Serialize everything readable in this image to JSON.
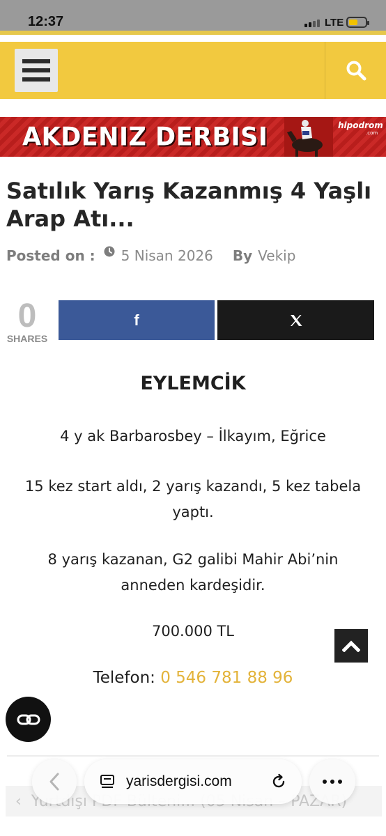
{
  "status_bar": {
    "time": "12:37",
    "network": "LTE"
  },
  "header": {
    "menu_icon": "hamburger-menu-icon",
    "search_icon": "search-icon",
    "brand_color": "#f2c93f"
  },
  "banner": {
    "title": "AKDENIZ DERBISI",
    "brand": "hipodrom",
    "brand_sub": ".com"
  },
  "article": {
    "title": "Satılık Yarış Kazanmış 4 Yaşlı Arap Atı...",
    "posted_label": "Posted on :",
    "date": "5 Nisan 2026",
    "by_label": "By",
    "author": "Vekip"
  },
  "share": {
    "count": "0",
    "label": "SHARES",
    "facebook_label": "f",
    "x_label": "𝕏",
    "facebook_color": "#3b5998"
  },
  "content": {
    "name": "EYLEMCİK",
    "pedigree": "4 y ak Barbarosbey – İlkayım, Eğrice",
    "record": "15 kez start aldı, 2 yarış kazandı, 5 kez tabela yaptı.",
    "relation": "8 yarış kazanan, G2 galibi Mahir Abi’nin anneden kardeşidir.",
    "price": "700.000 TL",
    "phone_label": "Telefon:",
    "phone_number": "0 546 781 88 96",
    "phone_color": "#e3b33a"
  },
  "previous_post": {
    "arrow": "‹",
    "text": "Yurtdışı PDF Bülteni... (05 Nisan – PAZAR)"
  },
  "browser": {
    "url": "yarisdergisi.com"
  }
}
